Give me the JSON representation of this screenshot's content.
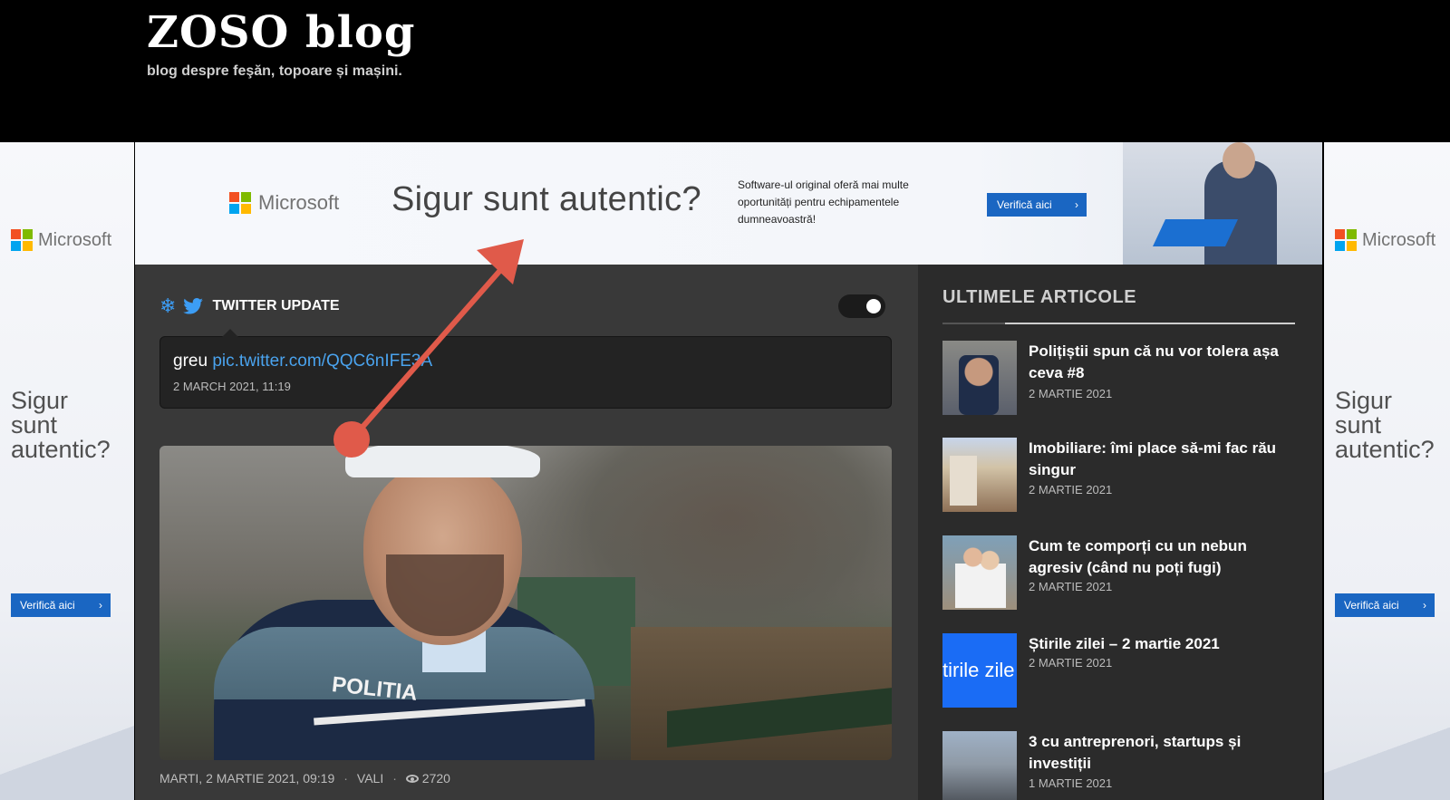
{
  "header": {
    "logo": "ZOSO blog",
    "tagline": "blog despre feşăn, topoare și mașini."
  },
  "ads": {
    "brand": "Microsoft",
    "brand_colors": [
      "#f25022",
      "#7fba00",
      "#00a4ef",
      "#ffb900"
    ],
    "cta_color": "#1a66c2",
    "banner": {
      "headline": "Sigur sunt autentic?",
      "copy": "Software-ul original oferă mai multe oportunități pentru echipamentele dumneavoastră!",
      "cta": "Verifică aici",
      "cta_arrow": "›"
    },
    "side_left": {
      "line1": "Sigur",
      "line2": "sunt",
      "line3": "autentic?",
      "cta": "Verifică aici",
      "cta_arrow": "›"
    },
    "side_right": {
      "line1": "Sigur",
      "line2": "sunt",
      "line3": "autentic?",
      "cta": "Verifică aici",
      "cta_arrow": "›"
    }
  },
  "twitter": {
    "title": "TWITTER UPDATE",
    "snow_icon": "❄",
    "tweet_text": "greu",
    "tweet_link": "pic.twitter.com/QQC6nIFE3A",
    "tweet_time": "2 MARCH 2021, 11:19",
    "accent": "#3c9df5"
  },
  "post": {
    "photo_label": "POLITIA",
    "date": "MARTI, 2 MARTIE 2021, 09:19",
    "sep": "·",
    "author": "VALI",
    "views": "2720"
  },
  "sidebar": {
    "title": "ULTIMELE ARTICOLE",
    "articles": [
      {
        "title": "Polițiștii spun că nu vor tolera așa ceva #8",
        "date": "2 MARTIE 2021"
      },
      {
        "title": "Imobiliare: îmi place să-mi fac rău singur",
        "date": "2 MARTIE 2021"
      },
      {
        "title": "Cum te comporți cu un nebun agresiv (când nu poți fugi)",
        "date": "2 MARTIE 2021"
      },
      {
        "title": "Știrile zilei – 2 martie 2021",
        "date": "2 MARTIE 2021",
        "thumb_text": "tirile zile"
      },
      {
        "title": "3 cu antreprenori, startups și investiții",
        "date": "1 MARTIE 2021"
      }
    ]
  },
  "annotation": {
    "color": "#e05a4a"
  }
}
